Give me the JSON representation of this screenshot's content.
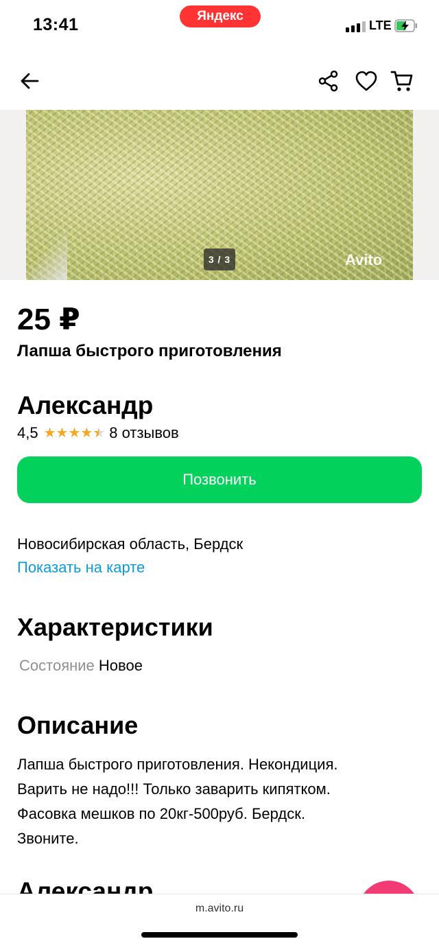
{
  "status_bar": {
    "time": "13:41",
    "browser_badge": "Яндекс",
    "network": "LTE",
    "battery_icon": "battery-charging-icon"
  },
  "nav": {
    "back_icon": "arrow-left-icon",
    "share_icon": "share-icon",
    "favorite_icon": "heart-icon",
    "cart_icon": "cart-icon"
  },
  "gallery": {
    "counter": "3 / 3",
    "watermark": "Avito"
  },
  "listing": {
    "price": "25 ₽",
    "title": "Лапша быстрого приготовления"
  },
  "seller": {
    "name": "Александр",
    "rating": "4,5",
    "rating_value": 4.5,
    "reviews": "8 отзывов"
  },
  "actions": {
    "call_label": "Позвонить",
    "call_color": "#02d15c"
  },
  "location": {
    "address": "Новосибирская область, Бердск",
    "map_link": "Показать на карте"
  },
  "specs": {
    "heading": "Характеристики",
    "items": [
      {
        "key": "Состояние",
        "value": "Новое"
      }
    ]
  },
  "description": {
    "heading": "Описание",
    "lines": [
      "Лапша быстрого приготовления. Некондиция.",
      "Варить не надо!!! Только заварить кипятком.",
      "Фасовка мешков по 20кг-500руб. Бердск.",
      "Звоните."
    ]
  },
  "seller_section": {
    "heading": "Александр"
  },
  "browser": {
    "url": "m.avito.ru"
  }
}
